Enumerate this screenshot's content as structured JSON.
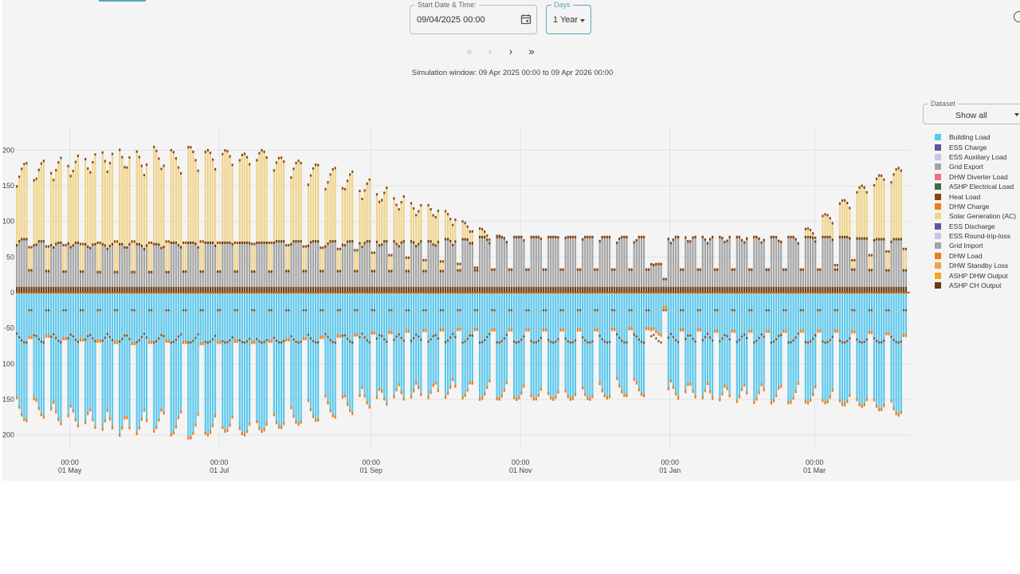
{
  "controls": {
    "start_label": "Start Date & Time:",
    "start_value": "09/04/2025 00:00",
    "days_label": "Days",
    "days_value": "1 Year",
    "nav_first": "«",
    "nav_prev": "‹",
    "nav_next": "›",
    "nav_last": "»",
    "simulation_window": "Simulation window: 09 Apr 2025 00:00 to 09 Apr 2026 00:00",
    "dataset_label": "Dataset",
    "dataset_value": "Show all"
  },
  "icons": [
    "calendar-icon",
    "chevron-double-left-icon",
    "chevron-left-icon",
    "chevron-right-icon",
    "chevron-double-right-icon",
    "info-icon",
    "caret-down-icon"
  ],
  "colors": {
    "accent": "#5aa7b8",
    "building_load": "#5bc8ee",
    "ess_charge": "#6a4fa0",
    "ess_auxiliary_load": "#c9c4e0",
    "grid_export": "#a4a4a4",
    "dhw_diverter_load": "#e8737a",
    "ashp_electrical_load": "#3e6b47",
    "heat_load": "#8b4513",
    "dhw_charge": "#ee7d1a",
    "solar_generation": "#f0d48a",
    "ess_discharge": "#6a4fa0",
    "ess_round_trip_loss": "#c9c4e0",
    "grid_import": "#a4a4a4",
    "dhw_load": "#ee7d1a",
    "dhw_standby_loss": "#f4a340",
    "ashp_dhw_output": "#f7a41c",
    "ashp_ch_output": "#6b3a10"
  },
  "chart_data": {
    "type": "bar",
    "stacked": true,
    "x_start": "2025-04-09",
    "x_end": "2026-04-09",
    "x_ticks": [
      {
        "date": "2025-05-01",
        "line1": "00:00",
        "line2": "01 May"
      },
      {
        "date": "2025-07-01",
        "line1": "00:00",
        "line2": "01 Jul"
      },
      {
        "date": "2025-09-01",
        "line1": "00:00",
        "line2": "01 Sep"
      },
      {
        "date": "2025-11-01",
        "line1": "00:00",
        "line2": "01 Nov"
      },
      {
        "date": "2026-01-01",
        "line1": "00:00",
        "line2": "01 Jan"
      },
      {
        "date": "2026-03-01",
        "line1": "00:00",
        "line2": "01 Mar"
      }
    ],
    "y_ticks": [
      200,
      150,
      100,
      50,
      0,
      -50,
      -100,
      -150,
      -200
    ],
    "y_tick_labels": [
      "200",
      "150",
      "100",
      "50",
      "0",
      "-50",
      "100",
      "150",
      "200"
    ],
    "ylim": [
      -210,
      210
    ],
    "grid": true,
    "legend_position": "right",
    "series": [
      {
        "name": "Building Load",
        "color": "#5bc8ee",
        "sign": "negative"
      },
      {
        "name": "ESS Charge",
        "color": "#6a4fa0",
        "sign": "negative"
      },
      {
        "name": "ESS Auxiliary Load",
        "color": "#c9c4e0",
        "sign": "negative"
      },
      {
        "name": "Grid Export",
        "color": "#a4a4a4",
        "sign": "negative"
      },
      {
        "name": "DHW Diverter Load",
        "color": "#e8737a",
        "sign": "negative"
      },
      {
        "name": "ASHP Electrical Load",
        "color": "#3e6b47",
        "sign": "negative"
      },
      {
        "name": "Heat Load",
        "color": "#8b4513",
        "sign": "negative"
      },
      {
        "name": "DHW Charge",
        "color": "#ee7d1a",
        "sign": "negative"
      },
      {
        "name": "Solar Generation (AC)",
        "color": "#f0d48a",
        "sign": "positive"
      },
      {
        "name": "ESS Discharge",
        "color": "#6a4fa0",
        "sign": "positive"
      },
      {
        "name": "ESS Round-trip-loss",
        "color": "#c9c4e0",
        "sign": "positive"
      },
      {
        "name": "Grid Import",
        "color": "#a4a4a4",
        "sign": "positive"
      },
      {
        "name": "DHW Load",
        "color": "#ee7d1a",
        "sign": "positive"
      },
      {
        "name": "DHW Standby Loss",
        "color": "#f4a340",
        "sign": "positive"
      },
      {
        "name": "ASHP DHW Output",
        "color": "#f7a41c",
        "sign": "positive"
      },
      {
        "name": "ASHP CH Output",
        "color": "#6b3a10",
        "sign": "positive"
      }
    ],
    "weekly_peaks": [
      {
        "week_start": "2025-04-09",
        "solar": 182,
        "grid_import": 75,
        "building_load": -180
      },
      {
        "week_start": "2025-04-16",
        "solar": 185,
        "grid_import": 72,
        "building_load": -175
      },
      {
        "week_start": "2025-04-23",
        "solar": 190,
        "grid_import": 70,
        "building_load": -185
      },
      {
        "week_start": "2025-04-30",
        "solar": 195,
        "grid_import": 70,
        "building_load": -190
      },
      {
        "week_start": "2025-05-07",
        "solar": 200,
        "grid_import": 68,
        "building_load": -195
      },
      {
        "week_start": "2025-05-14",
        "solar": 205,
        "grid_import": 68,
        "building_load": -200
      },
      {
        "week_start": "2025-05-21",
        "solar": 205,
        "grid_import": 68,
        "building_load": -205
      },
      {
        "week_start": "2025-05-28",
        "solar": 200,
        "grid_import": 68,
        "building_load": -200
      },
      {
        "week_start": "2025-06-04",
        "solar": 205,
        "grid_import": 68,
        "building_load": -195
      },
      {
        "week_start": "2025-06-11",
        "solar": 200,
        "grid_import": 70,
        "building_load": -200
      },
      {
        "week_start": "2025-06-18",
        "solar": 205,
        "grid_import": 70,
        "building_load": -205
      },
      {
        "week_start": "2025-06-25",
        "solar": 200,
        "grid_import": 70,
        "building_load": -200
      },
      {
        "week_start": "2025-07-02",
        "solar": 200,
        "grid_import": 70,
        "building_load": -195
      },
      {
        "week_start": "2025-07-09",
        "solar": 195,
        "grid_import": 70,
        "building_load": -200
      },
      {
        "week_start": "2025-07-16",
        "solar": 200,
        "grid_import": 70,
        "building_load": -195
      },
      {
        "week_start": "2025-07-23",
        "solar": 190,
        "grid_import": 72,
        "building_load": -190
      },
      {
        "week_start": "2025-07-30",
        "solar": 185,
        "grid_import": 72,
        "building_load": -185
      },
      {
        "week_start": "2025-08-06",
        "solar": 180,
        "grid_import": 72,
        "building_load": -180
      },
      {
        "week_start": "2025-08-13",
        "solar": 175,
        "grid_import": 72,
        "building_load": -175
      },
      {
        "week_start": "2025-08-20",
        "solar": 170,
        "grid_import": 72,
        "building_load": -170
      },
      {
        "week_start": "2025-08-27",
        "solar": 160,
        "grid_import": 72,
        "building_load": -162
      },
      {
        "week_start": "2025-09-03",
        "solar": 150,
        "grid_import": 72,
        "building_load": -160
      },
      {
        "week_start": "2025-09-10",
        "solar": 140,
        "grid_import": 72,
        "building_load": -155
      },
      {
        "week_start": "2025-09-17",
        "solar": 130,
        "grid_import": 72,
        "building_load": -152
      },
      {
        "week_start": "2025-09-24",
        "solar": 125,
        "grid_import": 72,
        "building_load": -150
      },
      {
        "week_start": "2025-10-01",
        "solar": 115,
        "grid_import": 75,
        "building_load": -148
      },
      {
        "week_start": "2025-10-08",
        "solar": 100,
        "grid_import": 75,
        "building_load": -148
      },
      {
        "week_start": "2025-10-15",
        "solar": 90,
        "grid_import": 78,
        "building_load": -150
      },
      {
        "week_start": "2025-10-22",
        "solar": 80,
        "grid_import": 78,
        "building_load": -150
      },
      {
        "week_start": "2025-10-29",
        "solar": 70,
        "grid_import": 78,
        "building_load": -150
      },
      {
        "week_start": "2025-11-05",
        "solar": 60,
        "grid_import": 78,
        "building_load": -150
      },
      {
        "week_start": "2025-11-12",
        "solar": 50,
        "grid_import": 78,
        "building_load": -150
      },
      {
        "week_start": "2025-11-19",
        "solar": 40,
        "grid_import": 78,
        "building_load": -150
      },
      {
        "week_start": "2025-11-26",
        "solar": 35,
        "grid_import": 78,
        "building_load": -150
      },
      {
        "week_start": "2025-12-03",
        "solar": 30,
        "grid_import": 78,
        "building_load": -148
      },
      {
        "week_start": "2025-12-10",
        "solar": 25,
        "grid_import": 78,
        "building_load": -145
      },
      {
        "week_start": "2025-12-17",
        "solar": 25,
        "grid_import": 78,
        "building_load": -145
      },
      {
        "week_start": "2025-12-24",
        "solar": 10,
        "grid_import": 40,
        "building_load": -60
      },
      {
        "week_start": "2025-12-31",
        "solar": 20,
        "grid_import": 78,
        "building_load": -150
      },
      {
        "week_start": "2026-01-07",
        "solar": 25,
        "grid_import": 78,
        "building_load": -150
      },
      {
        "week_start": "2026-01-14",
        "solar": 30,
        "grid_import": 78,
        "building_load": -155
      },
      {
        "week_start": "2026-01-21",
        "solar": 35,
        "grid_import": 78,
        "building_load": -155
      },
      {
        "week_start": "2026-01-28",
        "solar": 40,
        "grid_import": 78,
        "building_load": -155
      },
      {
        "week_start": "2026-02-04",
        "solar": 50,
        "grid_import": 78,
        "building_load": -155
      },
      {
        "week_start": "2026-02-11",
        "solar": 60,
        "grid_import": 78,
        "building_load": -155
      },
      {
        "week_start": "2026-02-18",
        "solar": 75,
        "grid_import": 78,
        "building_load": -155
      },
      {
        "week_start": "2026-02-25",
        "solar": 90,
        "grid_import": 78,
        "building_load": -155
      },
      {
        "week_start": "2026-03-04",
        "solar": 110,
        "grid_import": 78,
        "building_load": -155
      },
      {
        "week_start": "2026-03-11",
        "solar": 130,
        "grid_import": 78,
        "building_load": -158
      },
      {
        "week_start": "2026-03-18",
        "solar": 150,
        "grid_import": 76,
        "building_load": -160
      },
      {
        "week_start": "2026-03-25",
        "solar": 165,
        "grid_import": 75,
        "building_load": -165
      },
      {
        "week_start": "2026-04-01",
        "solar": 175,
        "grid_import": 75,
        "building_load": -172
      }
    ]
  }
}
